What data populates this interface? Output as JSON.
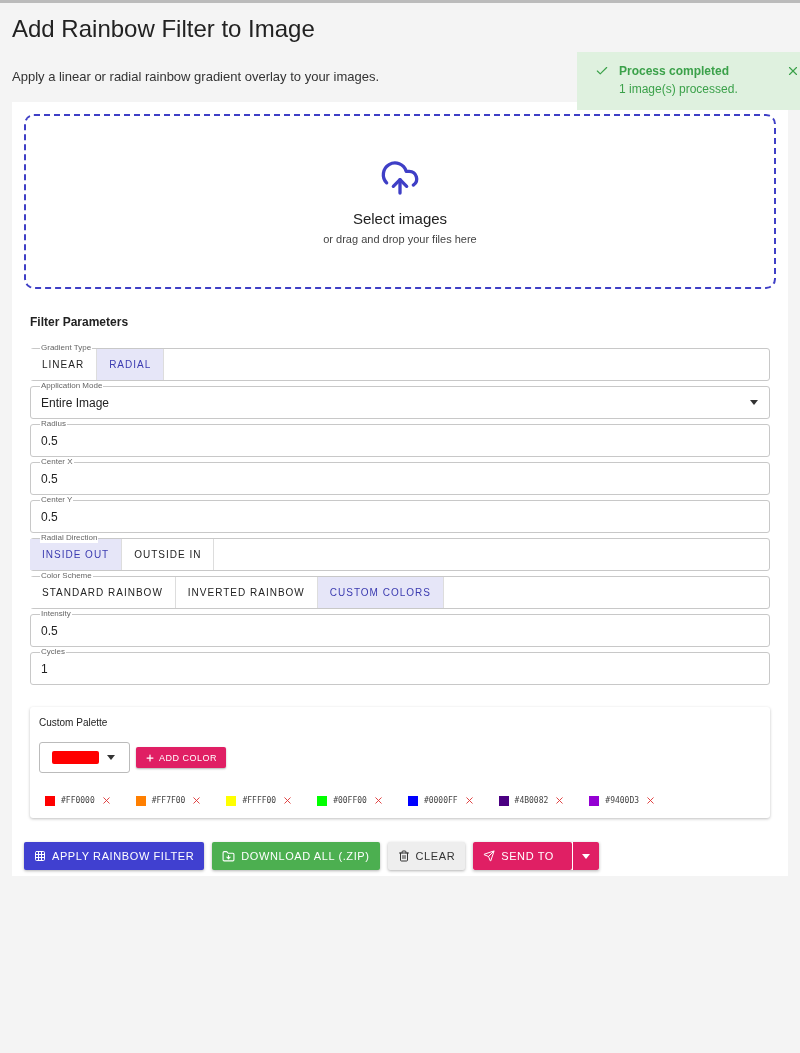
{
  "title": "Add Rainbow Filter to Image",
  "subtitle": "Apply a linear or radial rainbow gradient overlay to your images.",
  "toast": {
    "title": "Process completed",
    "message": "1 image(s) processed."
  },
  "dropzone": {
    "title": "Select images",
    "hint": "or drag and drop your files here"
  },
  "parameters": {
    "heading": "Filter Parameters",
    "fields": [
      {
        "kind": "toggle",
        "label": "Gradient Type",
        "options": [
          {
            "label": "LINEAR",
            "selected": false
          },
          {
            "label": "RADIAL",
            "selected": true
          }
        ]
      },
      {
        "kind": "select",
        "label": "Application Mode",
        "value": "Entire Image"
      },
      {
        "kind": "text",
        "label": "Radius",
        "value": "0.5"
      },
      {
        "kind": "text",
        "label": "Center X",
        "value": "0.5"
      },
      {
        "kind": "text",
        "label": "Center Y",
        "value": "0.5"
      },
      {
        "kind": "toggle",
        "label": "Radial Direction",
        "options": [
          {
            "label": "INSIDE OUT",
            "selected": true
          },
          {
            "label": "OUTSIDE IN",
            "selected": false
          }
        ]
      },
      {
        "kind": "toggle",
        "label": "Color Scheme",
        "options": [
          {
            "label": "STANDARD RAINBOW",
            "selected": false
          },
          {
            "label": "INVERTED RAINBOW",
            "selected": false
          },
          {
            "label": "CUSTOM COLORS",
            "selected": true
          }
        ]
      },
      {
        "kind": "text",
        "label": "Intensity",
        "value": "0.5"
      },
      {
        "kind": "text",
        "label": "Cycles",
        "value": "1"
      }
    ]
  },
  "palette": {
    "heading": "Custom Palette",
    "picker": {
      "color": "#ff0000"
    },
    "add_label": "ADD COLOR",
    "colors": [
      {
        "label": "#FF0000",
        "color": "#ff0000"
      },
      {
        "label": "#FF7F00",
        "color": "#ff7f00"
      },
      {
        "label": "#FFFF00",
        "color": "#ffff00"
      },
      {
        "label": "#00FF00",
        "color": "#00ff00"
      },
      {
        "label": "#0000FF",
        "color": "#0000ff"
      },
      {
        "label": "#4B0082",
        "color": "#4b0082"
      },
      {
        "label": "#9400D3",
        "color": "#9400d3"
      }
    ]
  },
  "actions": {
    "apply": "APPLY RAINBOW FILTER",
    "download": "DOWNLOAD ALL (.ZIP)",
    "clear": "CLEAR",
    "send": "SEND TO"
  }
}
